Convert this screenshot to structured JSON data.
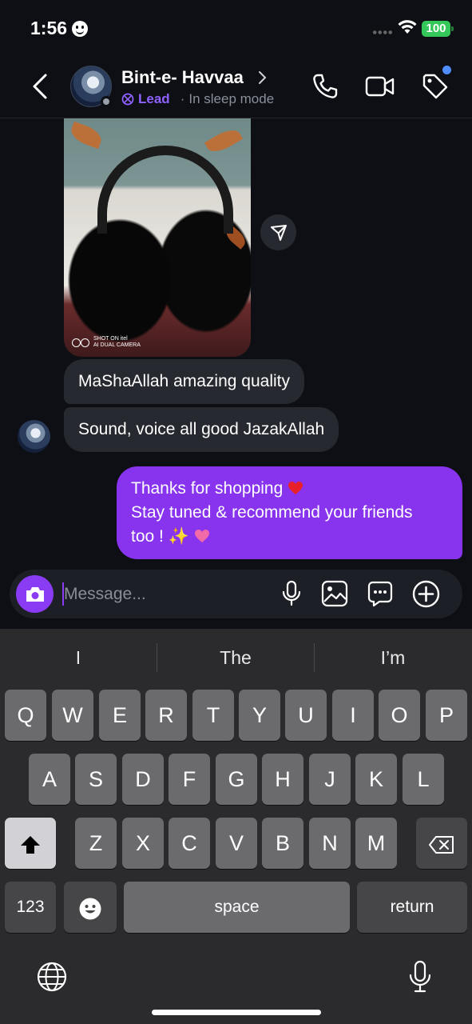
{
  "status_bar": {
    "time": "1:56",
    "battery": "100"
  },
  "header": {
    "contact_name": "Bint-e- Havvaa",
    "tag_label": "Lead",
    "status_text": "In sleep mode"
  },
  "messages": {
    "photo_caption_line1": "SHOT ON itel",
    "photo_caption_line2": "AI DUAL CAMERA",
    "incoming": [
      {
        "text": "MaShaAllah amazing quality"
      },
      {
        "text": "Sound, voice all good JazakAllah"
      }
    ],
    "outgoing": {
      "line1": "Thanks for shopping",
      "line2": "Stay tuned & recommend your friends",
      "line3": "too ! ✨"
    }
  },
  "composer": {
    "placeholder": "Message..."
  },
  "keyboard": {
    "suggestions": [
      "I",
      "The",
      "I’m"
    ],
    "row1": [
      "Q",
      "W",
      "E",
      "R",
      "T",
      "Y",
      "U",
      "I",
      "O",
      "P"
    ],
    "row2": [
      "A",
      "S",
      "D",
      "F",
      "G",
      "H",
      "J",
      "K",
      "L"
    ],
    "row3": [
      "Z",
      "X",
      "C",
      "V",
      "B",
      "N",
      "M"
    ],
    "numbers_label": "123",
    "space_label": "space",
    "return_label": "return"
  },
  "colors": {
    "accent": "#8833ee",
    "lead": "#8f62ff",
    "battery": "#34c759",
    "notification_dot": "#4f8dff"
  }
}
